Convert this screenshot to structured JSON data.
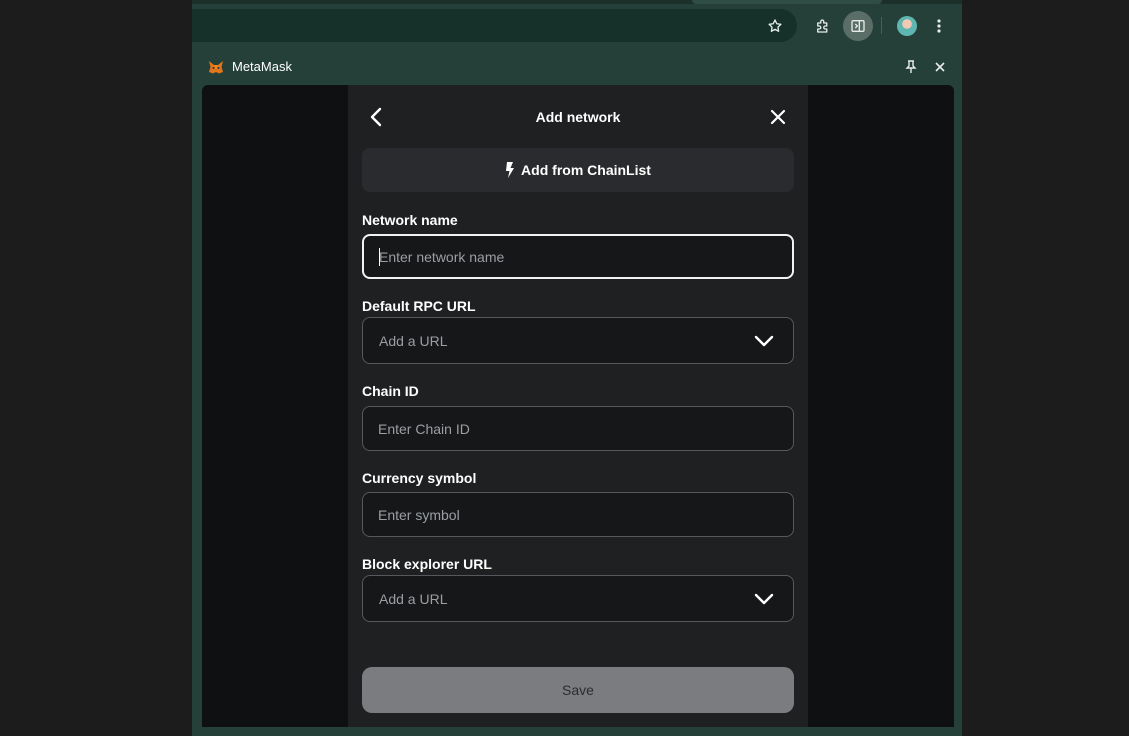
{
  "browser": {
    "toolbar_icons": [
      "star-icon",
      "extensions-icon",
      "side-panel-icon",
      "profile-avatar",
      "more-vert-icon"
    ],
    "panel_title": "MetaMask",
    "panel_icons": [
      "metamask-fox-icon",
      "pin-icon",
      "close-icon"
    ]
  },
  "modal": {
    "title": "Add network",
    "back_icon": "chevron-left-icon",
    "close_icon": "close-icon",
    "chainlist_button": "Add from ChainList",
    "chainlist_icon": "bolt-icon"
  },
  "form": {
    "network_name": {
      "label": "Network name",
      "value": "",
      "placeholder": "Enter network name"
    },
    "rpc_url": {
      "label": "Default RPC URL",
      "placeholder": "Add a URL"
    },
    "chain_id": {
      "label": "Chain ID",
      "value": "",
      "placeholder": "Enter Chain ID"
    },
    "currency_symbol": {
      "label": "Currency symbol",
      "value": "",
      "placeholder": "Enter symbol"
    },
    "block_explorer": {
      "label": "Block explorer URL",
      "placeholder": "Add a URL"
    }
  },
  "save_button": "Save",
  "colors": {
    "browser_frame": "#244038",
    "modal_bg": "#1f2022",
    "save_disabled": "#7b7c7f",
    "focus_border": "#f2f2f2"
  }
}
